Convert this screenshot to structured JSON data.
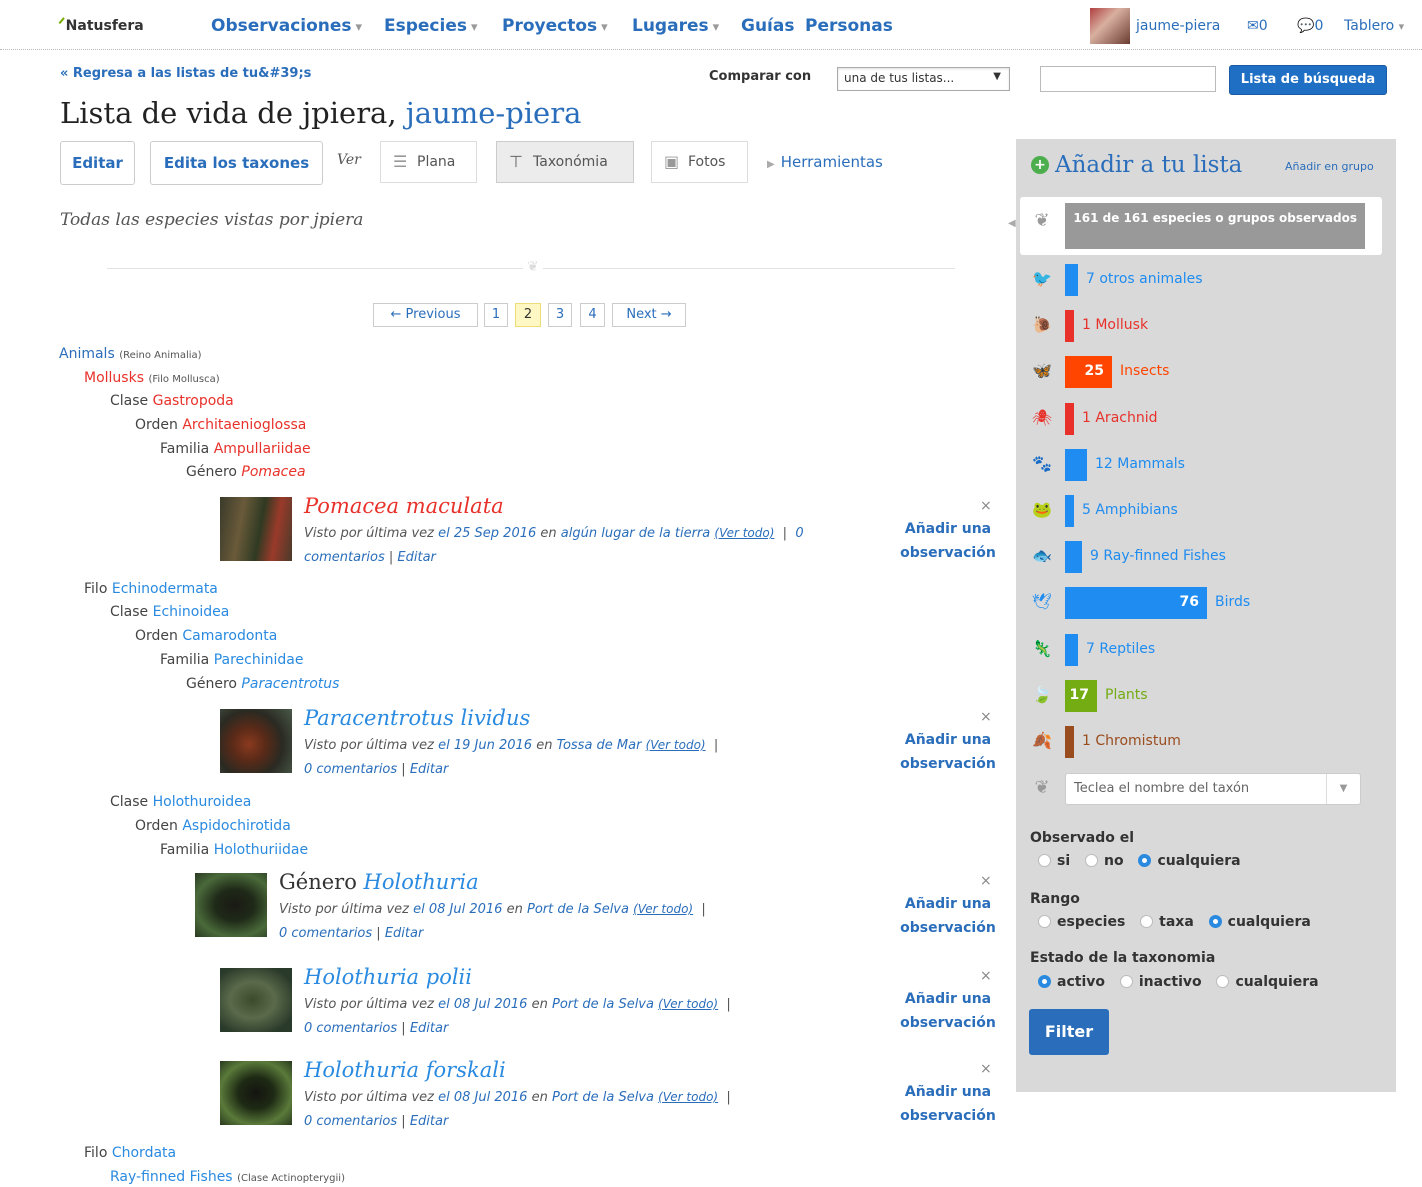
{
  "nav": {
    "logo": "Natusfera",
    "menus": [
      "Observaciones",
      "Especies",
      "Proyectos",
      "Lugares"
    ],
    "links": [
      "Guías",
      "Personas"
    ],
    "user": "jaume-piera",
    "messages": "0",
    "comments": "0",
    "dashboard": "Tablero"
  },
  "header": {
    "back_link": "« Regresa a las listas de tu&#39;s",
    "compare_label": "Comparar con",
    "compare_select": "una de tus listas...",
    "search_button": "Lista de búsqueda",
    "title_prefix": "Lista de vida de jpiera,",
    "title_user": "jaume-piera",
    "subtitle": "Todas las especies vistas por jpiera"
  },
  "toolbar": {
    "edit": "Editar",
    "edit_taxa": "Edita los taxones",
    "ver": "Ver",
    "views": [
      "Plana",
      "Taxonómia",
      "Fotos"
    ],
    "tools": "Herramientas"
  },
  "pagination": {
    "prev": "← Previous",
    "pages": [
      "1",
      "2",
      "3",
      "4"
    ],
    "current_page": "2",
    "next": "Next →"
  },
  "tree": [
    {
      "label": "Animals",
      "note": "(Reino Animalia)"
    },
    {
      "label": "Mollusks",
      "note": "(Filo Mollusca)"
    },
    {
      "rank": "Clase",
      "label": "Gastropoda"
    },
    {
      "rank": "Orden",
      "label": "Architaenioglossa"
    },
    {
      "rank": "Familia",
      "label": "Ampullariidae"
    },
    {
      "rank": "Género",
      "label": "Pomacea"
    },
    {
      "rank": "Filo",
      "label": "Echinodermata"
    },
    {
      "rank": "Clase",
      "label": "Echinoidea"
    },
    {
      "rank": "Orden",
      "label": "Camarodonta"
    },
    {
      "rank": "Familia",
      "label": "Parechinidae"
    },
    {
      "rank": "Género",
      "label": "Paracentrotus"
    },
    {
      "rank": "Clase",
      "label": "Holothuroidea"
    },
    {
      "rank": "Orden",
      "label": "Aspidochirotida"
    },
    {
      "rank": "Familia",
      "label": "Holothuriidae"
    },
    {
      "rank": "Filo",
      "label": "Chordata"
    },
    {
      "label": "Ray-finned Fishes",
      "note": "(Clase Actinopterygii)"
    }
  ],
  "species": [
    {
      "prefix": "",
      "name": "Pomacea maculata",
      "seen": "Visto por última vez",
      "date": "el 25 Sep 2016",
      "place_pre": "en",
      "place": "algún lugar de la tierra",
      "view_all": "(Ver todo)",
      "comments": "0 comentarios",
      "edit": "Editar"
    },
    {
      "prefix": "",
      "name": "Paracentrotus lividus",
      "seen": "Visto por última vez",
      "date": "el 19 Jun 2016",
      "place_pre": "en",
      "place": "Tossa de Mar",
      "view_all": "(Ver todo)",
      "comments": "0 comentarios",
      "edit": "Editar"
    },
    {
      "prefix": "Género",
      "name": "Holothuria",
      "seen": "Visto por última vez",
      "date": "el 08 Jul 2016",
      "place_pre": "en",
      "place": "Port de la Selva",
      "view_all": "(Ver todo)",
      "comments": "0 comentarios",
      "edit": "Editar"
    },
    {
      "prefix": "",
      "name": "Holothuria polii",
      "seen": "Visto por última vez",
      "date": "el 08 Jul 2016",
      "place_pre": "en",
      "place": "Port de la Selva",
      "view_all": "(Ver todo)",
      "comments": "0 comentarios",
      "edit": "Editar"
    },
    {
      "prefix": "",
      "name": "Holothuria forskali",
      "seen": "Visto por última vez",
      "date": "el 08 Jul 2016",
      "place_pre": "en",
      "place": "Port de la Selva",
      "view_all": "(Ver todo)",
      "comments": "0 comentarios",
      "edit": "Editar"
    }
  ],
  "add_observation": [
    "Añadir una",
    "observación"
  ],
  "close": "×",
  "sidebar": {
    "title": "Añadir a tu lista",
    "add_group": "Añadir en grupo",
    "total": "161 de 161 especies o grupos observados",
    "total_count": 161,
    "categories": [
      {
        "count": "7",
        "label": "otros animales",
        "color": "#1e8cf0",
        "icon": "other-animals-icon"
      },
      {
        "count": "1",
        "label": "Mollusk",
        "color": "#e8312a",
        "icon": "mollusk-icon"
      },
      {
        "count": "25",
        "label": "Insects",
        "color": "#ff4500",
        "icon": "insect-icon"
      },
      {
        "count": "1",
        "label": "Arachnid",
        "color": "#e8312a",
        "icon": "arachnid-icon"
      },
      {
        "count": "12",
        "label": "Mammals",
        "color": "#1e8cf0",
        "icon": "mammal-icon"
      },
      {
        "count": "5",
        "label": "Amphibians",
        "color": "#1e8cf0",
        "icon": "amphibian-icon"
      },
      {
        "count": "9",
        "label": "Ray-finned Fishes",
        "color": "#1e8cf0",
        "icon": "fish-icon"
      },
      {
        "count": "76",
        "label": "Birds",
        "color": "#1e8cf0",
        "icon": "bird-icon"
      },
      {
        "count": "7",
        "label": "Reptiles",
        "color": "#1e8cf0",
        "icon": "reptile-icon"
      },
      {
        "count": "17",
        "label": "Plants",
        "color": "#73ac13",
        "icon": "plant-icon"
      },
      {
        "count": "1",
        "label": "Chromistum",
        "color": "#994c1e",
        "icon": "chromista-icon"
      }
    ],
    "taxon_placeholder": "Teclea el nombre del taxón",
    "observed_label": "Observado el",
    "observed_options": [
      "si",
      "no",
      "cualquiera"
    ],
    "rank_label": "Rango",
    "rank_options": [
      "especies",
      "taxa",
      "cualquiera"
    ],
    "status_label": "Estado de la taxonomia",
    "status_options": [
      "activo",
      "inactivo",
      "cualquiera"
    ],
    "filter": "Filter"
  }
}
